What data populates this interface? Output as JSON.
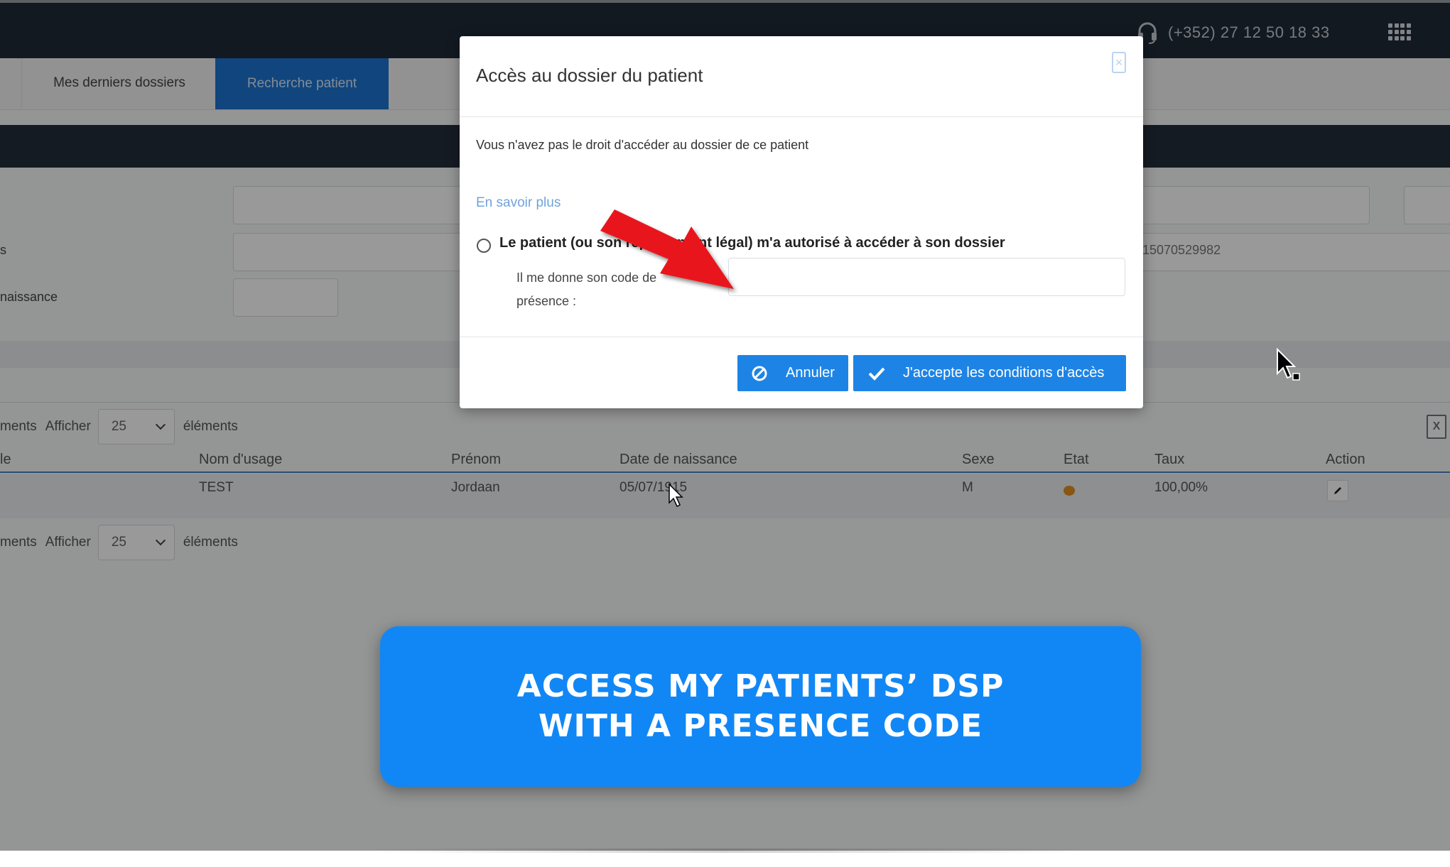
{
  "header": {
    "phone": "(+352) 27 12 50 18 33"
  },
  "tabs": [
    {
      "label": "Mes derniers dossiers",
      "active": false
    },
    {
      "label": "Recherche patient",
      "active": true
    }
  ],
  "search_form": {
    "label_row2": "s",
    "label_row3": "naissance",
    "partial_value": "15070529982"
  },
  "pager": {
    "elements_before": "ments",
    "show_label": "Afficher",
    "page_size": "25",
    "elements_after": "éléments"
  },
  "table": {
    "headers": {
      "partial": "le",
      "usage_name": "Nom d'usage",
      "first_name": "Prénom",
      "birth_date": "Date de naissance",
      "sex": "Sexe",
      "state": "Etat",
      "rate": "Taux",
      "action": "Action"
    },
    "rows": [
      {
        "usage_name": "TEST",
        "first_name": "Jordaan",
        "birth_date": "05/07/1915",
        "sex": "M",
        "state_color": "#e2901e",
        "rate": "100,00%"
      }
    ]
  },
  "modal": {
    "title": "Accès au dossier du patient",
    "message": "Vous n'avez pas le droit d'accéder au dossier de ce patient",
    "learn_more": "En savoir plus",
    "radio_label": "Le patient (ou son représentant légal) m'a autorisé à accéder à son dossier",
    "code_label": "Il me donne son code de présence :",
    "code_value": "",
    "cancel_label": "Annuler",
    "accept_label": "J'accepte les conditions d'accès"
  },
  "banner": {
    "line1": "ACCESS MY PATIENTS’ DSP",
    "line2": "WITH A PRESENCE CODE"
  },
  "colors": {
    "primary": "#1d84e6",
    "banner": "#1187f5",
    "arrow": "#e8141a",
    "topbar": "#202b38"
  },
  "icons": {
    "phone": "headset-icon",
    "apps": "grid-menu-icon",
    "close": "close-icon",
    "cancel": "ban-icon",
    "accept": "check-icon",
    "export": "excel-icon",
    "edit": "pencil-icon"
  }
}
